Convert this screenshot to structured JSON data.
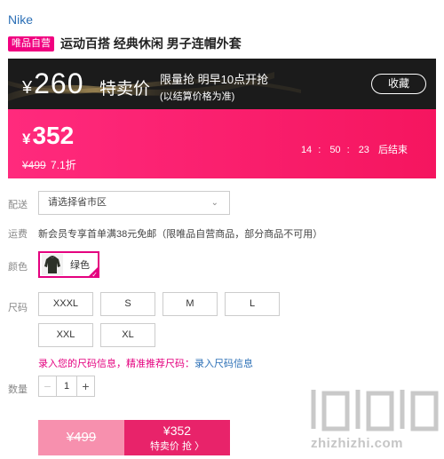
{
  "brand": "Nike",
  "product": {
    "badge": "唯品自营",
    "title": "运动百搭 经典休闲 男子连帽外套"
  },
  "promo": {
    "special_currency": "¥",
    "special_price": "260",
    "special_label": "特卖价",
    "flash_title": "限量抢 明早10点开抢",
    "flash_sub": "(以结算价格为准)",
    "favorite_label": "收藏",
    "sale_currency": "¥",
    "sale_price": "352",
    "original_price": "¥499",
    "discount": "7.1折",
    "countdown": {
      "h": "14",
      "m": "50",
      "s": "23",
      "suffix": "后结束"
    }
  },
  "delivery": {
    "label": "配送",
    "region_placeholder": "请选择省市区",
    "shipping_label": "运费",
    "shipping_text": "新会员专享首单满38元免邮（限唯品自营商品，部分商品不可用）"
  },
  "color": {
    "label": "颜色",
    "options": [
      {
        "name": "绿色",
        "selected": true
      }
    ]
  },
  "size": {
    "label": "尺码",
    "options": [
      "XXXL",
      "S",
      "M",
      "L",
      "XXL",
      "XL"
    ],
    "tip_text": "录入您的尺码信息，精准推荐尺码：",
    "tip_link": "录入尺码信息"
  },
  "quantity": {
    "label": "数量",
    "value": "1",
    "minus": "−",
    "plus": "+"
  },
  "buy": {
    "original_price": "¥499",
    "special_price": "¥352",
    "button_label": "特卖价 抢 〉"
  },
  "watermark": {
    "text": "zhizhizhi.com"
  },
  "colors": {
    "accent": "#e4007f",
    "pink": "#f5155f",
    "dark": "#1b1b1b",
    "link": "#2b6fb6"
  }
}
